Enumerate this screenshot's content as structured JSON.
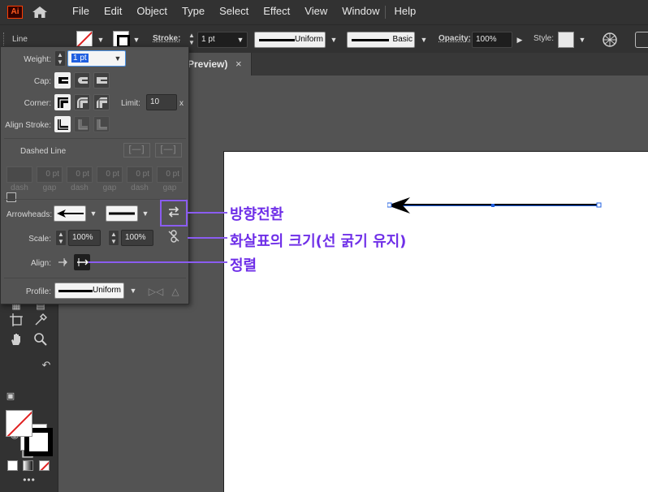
{
  "menubar": {
    "logo": "Ai",
    "menus": [
      "File",
      "Edit",
      "Object",
      "Type",
      "Select",
      "Effect",
      "View",
      "Window",
      "Help"
    ]
  },
  "control_bar": {
    "selection_type": "Line",
    "stroke_label": "Stroke:",
    "stroke_weight": "1 pt",
    "variable_width_profile": "Uniform",
    "brush": "Basic",
    "opacity_label": "Opacity:",
    "opacity_value": "100%",
    "style_label": "Style:"
  },
  "document_tab": {
    "title_fragment": "Preview)",
    "close_glyph": "×"
  },
  "stroke_panel": {
    "weight_label": "Weight:",
    "weight_value": "1 pt",
    "cap_label": "Cap:",
    "corner_label": "Corner:",
    "limit_label": "Limit:",
    "limit_value": "10",
    "limit_suffix": "x",
    "align_stroke_label": "Align Stroke:",
    "dashed_line_label": "Dashed Line",
    "dash_values": [
      "",
      "0 pt",
      "0 pt",
      "0 pt",
      "0 pt",
      "0 pt"
    ],
    "dash_labels": [
      "dash",
      "gap",
      "dash",
      "gap",
      "dash",
      "gap"
    ],
    "arrowheads_label": "Arrowheads:",
    "scale_label": "Scale:",
    "scale_start": "100%",
    "scale_end": "100%",
    "align_label": "Align:",
    "profile_label": "Profile:",
    "profile_value": "Uniform"
  },
  "annotations": {
    "swap": "방향전환",
    "scale": "화살표의 크기(선 굵기 유지)",
    "align": "정렬",
    "color": "#8a5cf0"
  },
  "colors": {
    "app_bg": "#535353",
    "chrome": "#323232",
    "artboard": "#ffffff",
    "selection": "#1f5fe0",
    "ai_logo": "#ff3d00"
  }
}
